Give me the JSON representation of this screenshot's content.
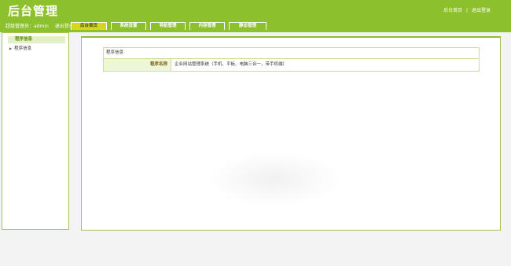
{
  "header": {
    "logo_text": "后台管理",
    "links": {
      "home": "后台首页",
      "separator": "|",
      "logout": "退出登录"
    },
    "user_label": "超级管理员：admin",
    "user_logout": "退出登录"
  },
  "tabs": [
    {
      "label": "后台首页",
      "active": true
    },
    {
      "label": "系统设置",
      "active": false
    },
    {
      "label": "导航管理",
      "active": false
    },
    {
      "label": "内容管理",
      "active": false
    },
    {
      "label": "静态管理",
      "active": false
    }
  ],
  "sidebar": {
    "heading": "程序信息",
    "items": [
      {
        "label": "程序信息"
      }
    ]
  },
  "main": {
    "table_title": "程序信息",
    "rows": [
      {
        "label": "程序名称",
        "value": "企业网站管理系统（手机、平板、电脑三合一，带手机端）"
      }
    ]
  },
  "colors": {
    "brand_green": "#8cc02c",
    "active_tab": "#d6d61e",
    "label_bg": "#eef6d8"
  }
}
